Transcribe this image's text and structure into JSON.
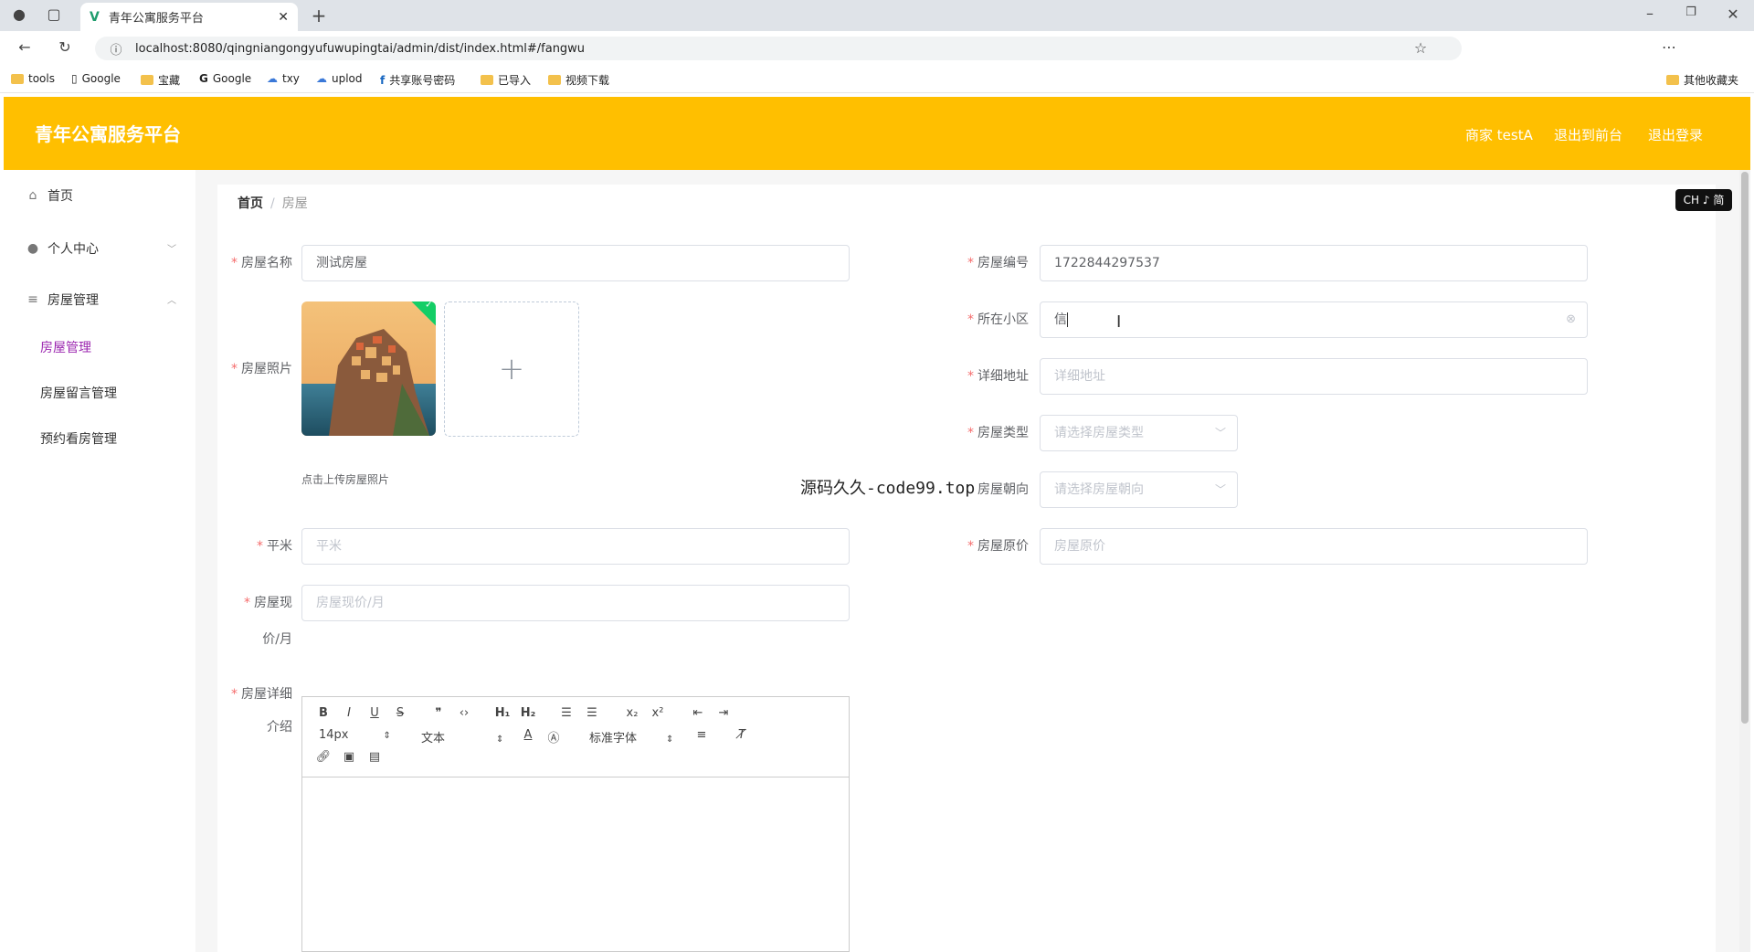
{
  "browser": {
    "tab_title": "青年公寓服务平台",
    "url": "localhost:8080/qingniangongyufuwupingtai/admin/dist/index.html#/fangwu",
    "bookmarks": [
      "tools",
      "Google",
      "宝藏",
      "Google",
      "txy",
      "uplod",
      "共享账号密码",
      "已导入",
      "视频下载"
    ],
    "other_bookmarks": "其他收藏夹"
  },
  "header": {
    "title": "青年公寓服务平台",
    "user": "商家 testA",
    "to_front": "退出到前台",
    "logout": "退出登录"
  },
  "sidebar": {
    "home": "首页",
    "personal": "个人中心",
    "house_mgmt": "房屋管理",
    "sub_items": [
      "房屋管理",
      "房屋留言管理",
      "预约看房管理"
    ]
  },
  "breadcrumb": {
    "home": "首页",
    "current": "房屋"
  },
  "lang_badge": "CH ♪ 简",
  "form": {
    "name_label": "房屋名称",
    "name_value": "测试房屋",
    "code_label": "房屋编号",
    "code_value": "1722844297537",
    "photo_label": "房屋照片",
    "community_label": "所在小区",
    "community_value": "信",
    "address_label": "详细地址",
    "address_placeholder": "详细地址",
    "type_label": "房屋类型",
    "type_placeholder": "请选择房屋类型",
    "upload_tip": "点击上传房屋照片",
    "orientation_label": "房屋朝向",
    "orientation_placeholder": "请选择房屋朝向",
    "area_label": "平米",
    "area_placeholder": "平米",
    "origprice_label": "房屋原价",
    "origprice_placeholder": "房屋原价",
    "price_label_1": "房屋现",
    "price_label_2": "价/月",
    "price_placeholder": "房屋现价/月",
    "detail_label_1": "房屋详细",
    "detail_label_2": "介绍"
  },
  "editor": {
    "font_size": "14px",
    "block_format": "文本",
    "font_family": "标准字体"
  },
  "watermark": "源码久久-code99.top",
  "colors": {
    "header": "#ffbf00",
    "active_menu": "#9c27b0",
    "required": "#f56c6c"
  }
}
